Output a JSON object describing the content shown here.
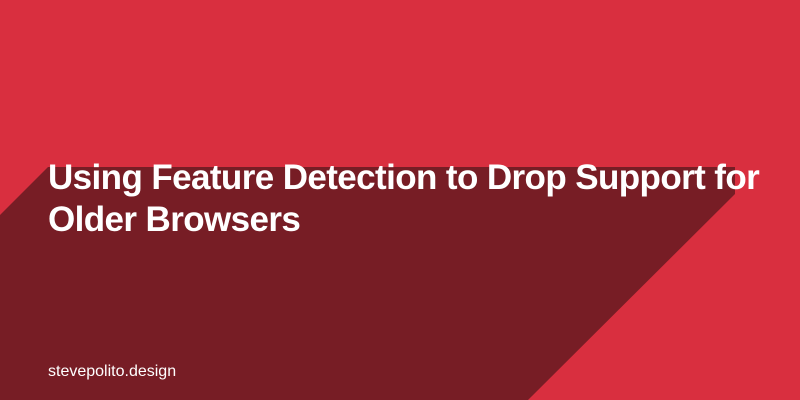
{
  "card": {
    "title": "Using Feature Detection to Drop Support for Older Browsers",
    "site": "stevepolito.design",
    "colors": {
      "background": "#d92f3f",
      "shadow": "#771d25",
      "text": "#ffffff"
    }
  }
}
